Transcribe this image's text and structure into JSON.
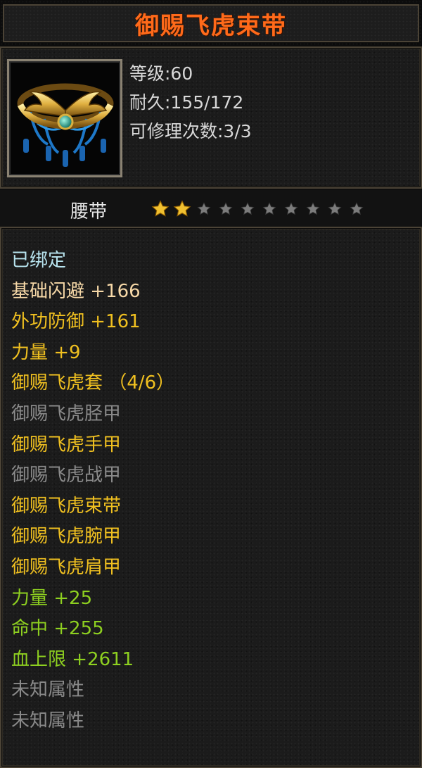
{
  "item": {
    "name": "御赐飞虎束带",
    "type": "腰带",
    "icon": "belt-icon",
    "stats": [
      "等级:60",
      "耐久:155/172",
      "可修理次数:3/3"
    ],
    "stars": {
      "filled": 2,
      "total": 10
    }
  },
  "colors": {
    "title": "#ff6a1a",
    "bound": "#b8e4ef",
    "base_attr": "#f7d9a8",
    "yellow_attr": "#f0c020",
    "gray": "#8a8a8a",
    "green": "#8ed020",
    "star_gold": "#f0c030",
    "star_gray": "#7c7c7c"
  },
  "attributes": [
    {
      "text": "已绑定",
      "color": "#b8e4ef"
    },
    {
      "text": "基础闪避 +166",
      "color": "#f7d9a8"
    },
    {
      "text": "外功防御 +161",
      "color": "#f0c020"
    },
    {
      "text": "力量 +9",
      "color": "#f0c020"
    },
    {
      "text": "御赐飞虎套 （4/6）",
      "color": "#f0c020"
    },
    {
      "text": "御赐飞虎胫甲",
      "color": "#8a8a8a"
    },
    {
      "text": "御赐飞虎手甲",
      "color": "#f0c020"
    },
    {
      "text": "御赐飞虎战甲",
      "color": "#8a8a8a"
    },
    {
      "text": "御赐飞虎束带",
      "color": "#f0c020"
    },
    {
      "text": "御赐飞虎腕甲",
      "color": "#f0c020"
    },
    {
      "text": "御赐飞虎肩甲",
      "color": "#f0c020"
    },
    {
      "text": "力量 +25",
      "color": "#8ed020"
    },
    {
      "text": "命中 +255",
      "color": "#8ed020"
    },
    {
      "text": "血上限 +2611",
      "color": "#8ed020"
    },
    {
      "text": "未知属性",
      "color": "#8a8a8a"
    },
    {
      "text": "未知属性",
      "color": "#8a8a8a"
    }
  ]
}
